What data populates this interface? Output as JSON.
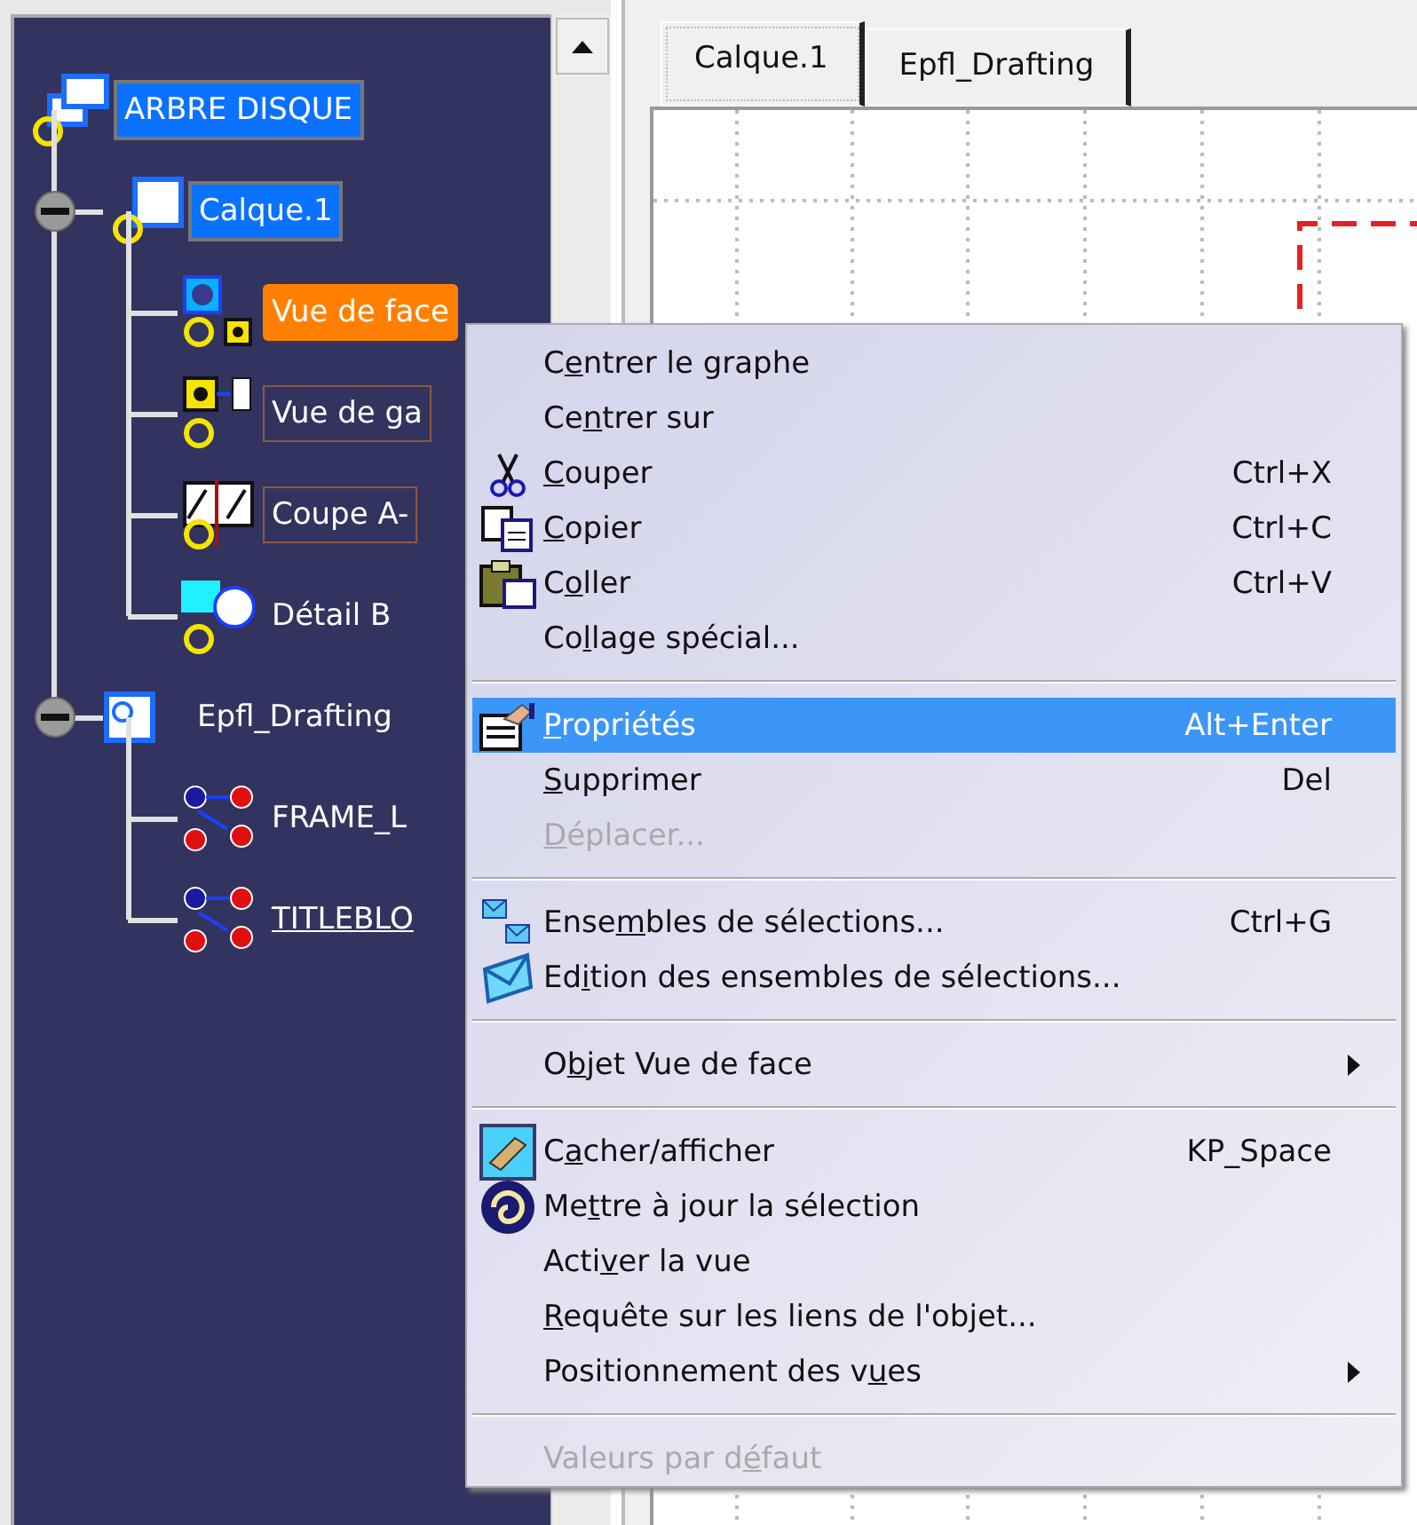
{
  "tree": {
    "label": "ARBRE DISQUE",
    "kind": "document",
    "highlighted": true,
    "current": false,
    "outlined": false,
    "underlined": false,
    "children": [
      {
        "label": "Calque.1",
        "kind": "sheet",
        "highlighted": true,
        "current": false,
        "outlined": false,
        "underlined": false,
        "expanded": true,
        "children": [
          {
            "label": "Vue de face",
            "kind": "front-view",
            "highlighted": false,
            "current": true,
            "outlined": false,
            "underlined": false
          },
          {
            "label": "Vue de ga",
            "kind": "left-view",
            "highlighted": false,
            "current": false,
            "outlined": true,
            "underlined": false
          },
          {
            "label": "Coupe A-",
            "kind": "section-view",
            "highlighted": false,
            "current": false,
            "outlined": true,
            "underlined": false
          },
          {
            "label": "Détail B",
            "kind": "detail-view",
            "highlighted": false,
            "current": false,
            "outlined": false,
            "underlined": false
          }
        ]
      },
      {
        "label": "Epfl_Drafting",
        "kind": "background-sheet",
        "highlighted": false,
        "current": false,
        "outlined": false,
        "underlined": false,
        "expanded": true,
        "children": [
          {
            "label": "FRAME_L",
            "kind": "ditto",
            "highlighted": false,
            "current": false,
            "outlined": false,
            "underlined": false
          },
          {
            "label": "TITLEBLO",
            "kind": "ditto",
            "highlighted": false,
            "current": false,
            "outlined": false,
            "underlined": true
          }
        ]
      }
    ]
  },
  "tabs": [
    {
      "label": "Calque.1",
      "selected": true
    },
    {
      "label": "Epfl_Drafting",
      "selected": false
    }
  ],
  "context_menu": [
    {
      "kind": "item",
      "label": [
        "C",
        {
          "key": "e"
        },
        "ntrer le graphe"
      ],
      "selected": false,
      "disabled": false,
      "submenu": false
    },
    {
      "kind": "item",
      "label": [
        "Ce",
        {
          "key": "n"
        },
        "trer sur"
      ],
      "selected": false,
      "disabled": false,
      "submenu": false
    },
    {
      "kind": "item",
      "label": [
        {
          "key": "C"
        },
        "ouper"
      ],
      "shortcut": "Ctrl+X",
      "selected": false,
      "disabled": false,
      "submenu": false
    },
    {
      "kind": "item",
      "label": [
        {
          "key": "C"
        },
        "opier"
      ],
      "shortcut": "Ctrl+C",
      "selected": false,
      "disabled": false,
      "submenu": false
    },
    {
      "kind": "item",
      "label": [
        "C",
        {
          "key": "o"
        },
        "ller"
      ],
      "shortcut": "Ctrl+V",
      "selected": false,
      "disabled": false,
      "submenu": false
    },
    {
      "kind": "item",
      "label": [
        "Co",
        {
          "key": "l"
        },
        "lage spécial..."
      ],
      "selected": false,
      "disabled": false,
      "submenu": false
    },
    {
      "kind": "separator"
    },
    {
      "kind": "item",
      "label": [
        {
          "key": "P"
        },
        "ropriétés"
      ],
      "shortcut": "Alt+Enter",
      "selected": true,
      "disabled": false,
      "submenu": false
    },
    {
      "kind": "item",
      "label": [
        {
          "key": "S"
        },
        "upprimer"
      ],
      "shortcut": "Del",
      "selected": false,
      "disabled": false,
      "submenu": false
    },
    {
      "kind": "item",
      "label": [
        {
          "key": "D"
        },
        "éplacer..."
      ],
      "selected": false,
      "disabled": true,
      "submenu": false
    },
    {
      "kind": "separator"
    },
    {
      "kind": "item",
      "label": [
        "Ense",
        {
          "key": "m"
        },
        "bles de sélections..."
      ],
      "shortcut": "Ctrl+G",
      "selected": false,
      "disabled": false,
      "submenu": false
    },
    {
      "kind": "item",
      "label": [
        "Ed",
        {
          "key": "i"
        },
        "tion des ensembles de sélections..."
      ],
      "selected": false,
      "disabled": false,
      "submenu": false
    },
    {
      "kind": "separator"
    },
    {
      "kind": "item",
      "label": [
        "O",
        {
          "key": "b"
        },
        "jet Vue de face"
      ],
      "selected": false,
      "disabled": false,
      "submenu": true
    },
    {
      "kind": "separator"
    },
    {
      "kind": "item",
      "label": [
        "C",
        {
          "key": "a"
        },
        "cher/afficher"
      ],
      "shortcut": "KP_Space",
      "selected": false,
      "disabled": false,
      "submenu": false
    },
    {
      "kind": "item",
      "label": [
        "Me",
        {
          "key": "t"
        },
        "tre à jour la sélection"
      ],
      "selected": false,
      "disabled": false,
      "submenu": false
    },
    {
      "kind": "item",
      "label": [
        "Acti",
        {
          "key": "v"
        },
        "er la vue"
      ],
      "selected": false,
      "disabled": false,
      "submenu": false
    },
    {
      "kind": "item",
      "label": [
        {
          "key": "R"
        },
        "equête sur les liens de l'objet..."
      ],
      "selected": false,
      "disabled": false,
      "submenu": false
    },
    {
      "kind": "item",
      "label": [
        "Positionnement des v",
        {
          "key": "u"
        },
        "es"
      ],
      "selected": false,
      "disabled": false,
      "submenu": true
    },
    {
      "kind": "separator"
    },
    {
      "kind": "item",
      "label": [
        "Valeurs par d",
        {
          "key": "é"
        },
        "faut"
      ],
      "selected": false,
      "disabled": true,
      "submenu": false
    }
  ]
}
